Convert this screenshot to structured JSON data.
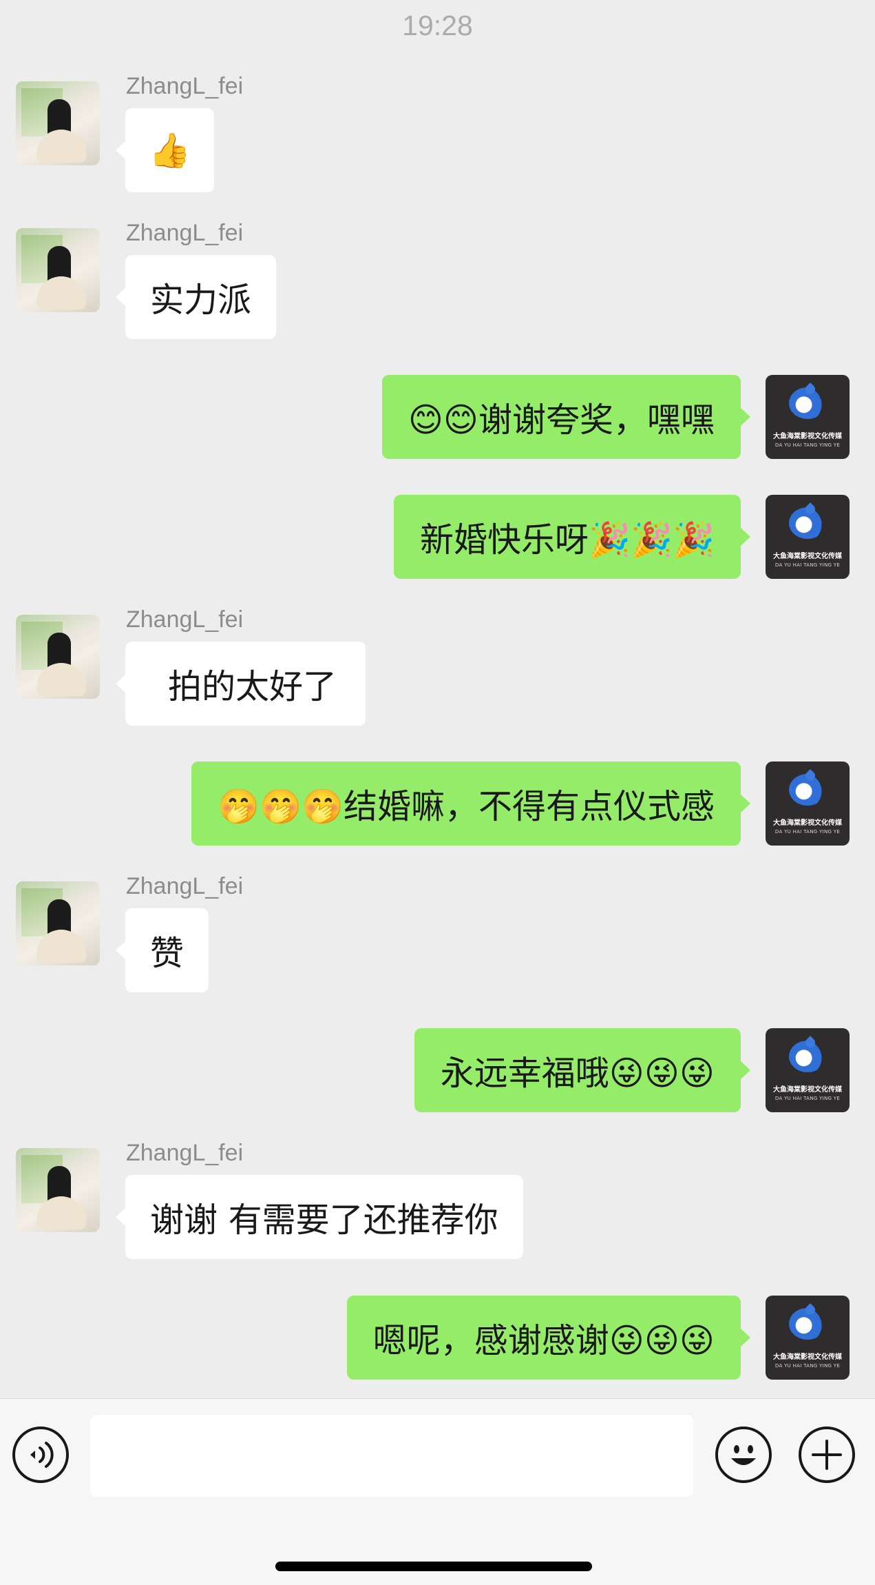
{
  "chat": {
    "timestamp": "19:28",
    "friend_name": "ZhangL_fei",
    "messages": [
      {
        "from": "friend",
        "text": "👍"
      },
      {
        "from": "friend",
        "text": "实力派"
      },
      {
        "from": "me",
        "text": "😊😊谢谢夸奖，嘿嘿"
      },
      {
        "from": "me",
        "text": "新婚快乐呀🎉🎉🎉"
      },
      {
        "from": "friend",
        "text": "拍的太好了"
      },
      {
        "from": "me",
        "text": "🤭🤭🤭结婚嘛，不得有点仪式感"
      },
      {
        "from": "friend",
        "text": "赞"
      },
      {
        "from": "me",
        "text": "永远幸福哦😜😜😜"
      },
      {
        "from": "friend",
        "text": "谢谢 有需要了还推荐你"
      },
      {
        "from": "me",
        "text": "嗯呢，感谢感谢😜😜😜"
      }
    ]
  },
  "my_avatar": {
    "logo_text_cn": "大鱼海棠影视文化传媒",
    "logo_text_en": "DA YU HAI TANG YING YE"
  },
  "input_bar": {
    "icons": [
      "voice-icon",
      "emoji-icon",
      "plus-icon"
    ],
    "text_value": ""
  }
}
